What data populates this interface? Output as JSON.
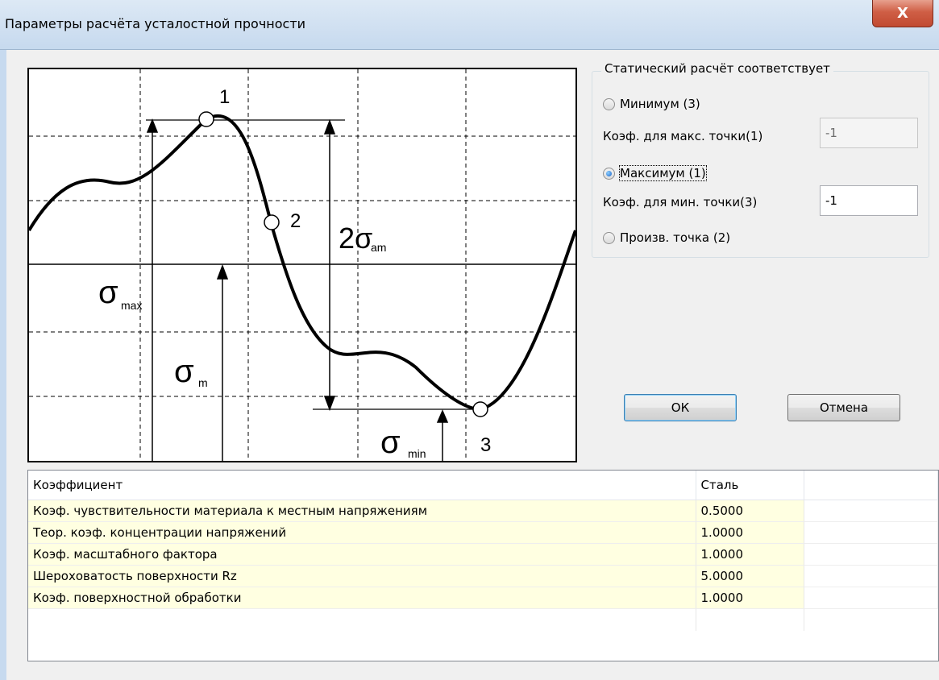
{
  "window": {
    "title": "Параметры расчёта усталостной прочности",
    "close_label": "X"
  },
  "diagram": {
    "labels": {
      "p1": "1",
      "p2": "2",
      "p3": "3",
      "sigma_am": "2σ",
      "sigma_am_sub": "am",
      "sigma_max": "σ",
      "sigma_max_sub": "max",
      "sigma_m": "σ",
      "sigma_m_sub": "m",
      "sigma_min": "σ",
      "sigma_min_sub": "min"
    }
  },
  "static_group": {
    "legend": "Статический расчёт соответствует",
    "option_min": "Минимум (3)",
    "coef_max_label": "Коэф. для макс. точки(1)",
    "coef_max_value": "-1",
    "option_max": "Максимум (1)",
    "coef_min_label": "Коэф. для мин. точки(3)",
    "coef_min_value": "-1",
    "option_arbitrary": "Произв. точка (2)",
    "selected": "max"
  },
  "buttons": {
    "ok": "ОК",
    "cancel": "Отмена"
  },
  "table": {
    "columns": [
      "Коэффициент",
      "Сталь",
      ""
    ],
    "rows": [
      [
        "Коэф. чувствительности материала к местным напряжениям",
        "0.5000"
      ],
      [
        "Теор. коэф. концентрации напряжений",
        "1.0000"
      ],
      [
        "Коэф. масштабного фактора",
        "1.0000"
      ],
      [
        "Шероховатость поверхности Rz",
        "5.0000"
      ],
      [
        "Коэф. поверхностной обработки",
        "1.0000"
      ]
    ]
  }
}
